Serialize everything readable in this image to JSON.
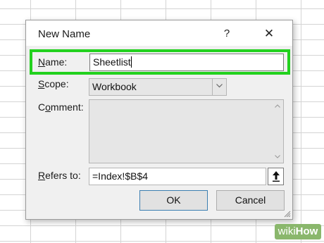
{
  "dialog": {
    "title": "New Name",
    "help_label": "?",
    "close_label": "✕"
  },
  "fields": {
    "name": {
      "label_underlined": "N",
      "label_rest": "ame:",
      "value": "Sheetlist"
    },
    "scope": {
      "label_underlined": "S",
      "label_rest": "cope:",
      "value": "Workbook"
    },
    "comment": {
      "label_prefix": "C",
      "label_underlined": "o",
      "label_rest": "mment:",
      "value": ""
    },
    "refers_to": {
      "label_prefix": "",
      "label_underlined": "R",
      "label_rest": "efers to:",
      "value": "=Index!$B$4"
    }
  },
  "buttons": {
    "ok": "OK",
    "cancel": "Cancel"
  },
  "icons": {
    "scope_dropdown": "chevron-down-icon",
    "collapse": "arrow-up-icon",
    "scroll_up": "scroll-up-icon",
    "scroll_down": "scroll-down-icon"
  },
  "watermark": {
    "wiki": "wiki",
    "how": "How"
  },
  "colors": {
    "highlight": "#22d11e",
    "watermark_bg": "#8ab76c",
    "ok_border": "#3c7fb1"
  }
}
